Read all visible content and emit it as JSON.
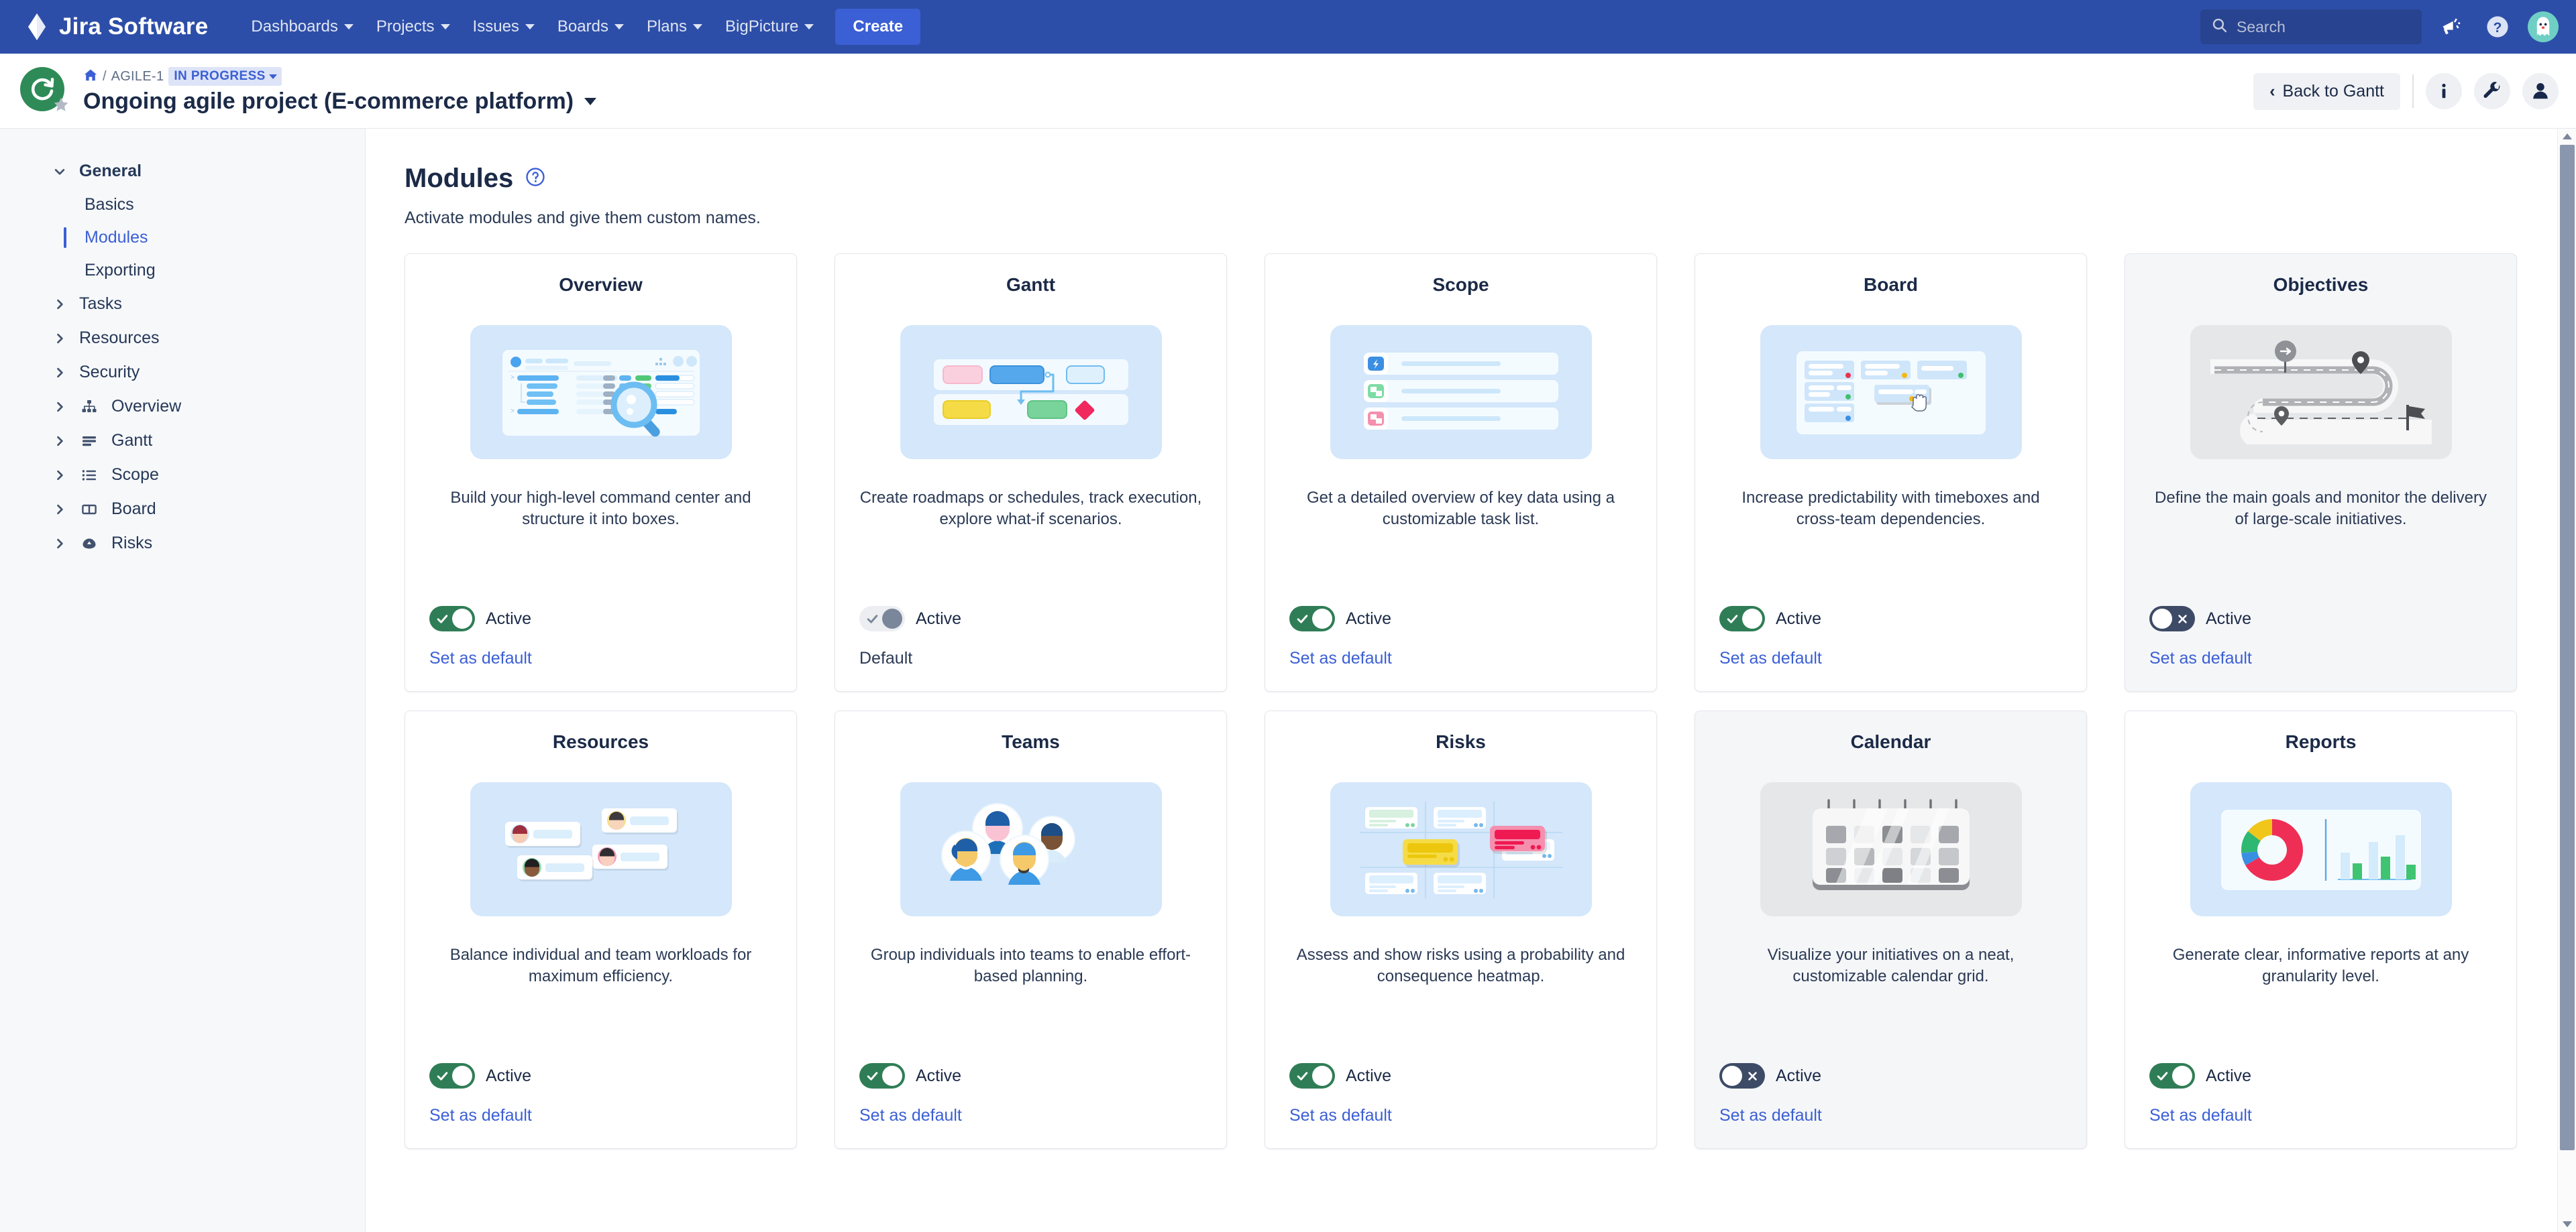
{
  "topnav": {
    "brand": "Jira Software",
    "menu": [
      {
        "label": "Dashboards",
        "has_caret": true
      },
      {
        "label": "Projects",
        "has_caret": true
      },
      {
        "label": "Issues",
        "has_caret": true
      },
      {
        "label": "Boards",
        "has_caret": true
      },
      {
        "label": "Plans",
        "has_caret": true
      },
      {
        "label": "BigPicture",
        "has_caret": true
      }
    ],
    "create_label": "Create",
    "search_placeholder": "Search",
    "icons": [
      "megaphone-icon",
      "help-icon",
      "user-avatar"
    ],
    "bg_color": "#2d4ea8",
    "create_bg": "#3b5fd4"
  },
  "project_header": {
    "breadcrumb_home": "home-icon",
    "breadcrumb_separator": "/",
    "breadcrumb_key": "AGILE-1",
    "status": "IN PROGRESS",
    "status_color": "#3b5fd4",
    "status_bg": "#dde4f8",
    "title": "Ongoing agile project (E-commerce platform)",
    "back_button": "Back to Gantt",
    "actions": [
      "info-icon",
      "wrench-icon",
      "person-icon"
    ],
    "avatar_color": "#2e8b57"
  },
  "sidebar": {
    "groups": [
      {
        "label": "General",
        "expanded": true,
        "bold": true,
        "icon": null,
        "items": [
          {
            "label": "Basics",
            "active": false
          },
          {
            "label": "Modules",
            "active": true
          },
          {
            "label": "Exporting",
            "active": false
          }
        ]
      },
      {
        "label": "Tasks",
        "expanded": false,
        "bold": false,
        "icon": null,
        "items": []
      },
      {
        "label": "Resources",
        "expanded": false,
        "bold": false,
        "icon": null,
        "items": []
      },
      {
        "label": "Security",
        "expanded": false,
        "bold": false,
        "icon": null,
        "items": []
      },
      {
        "label": "Overview",
        "expanded": false,
        "bold": false,
        "icon": "sitemap-icon",
        "items": []
      },
      {
        "label": "Gantt",
        "expanded": false,
        "bold": false,
        "icon": "gantt-bars-icon",
        "items": []
      },
      {
        "label": "Scope",
        "expanded": false,
        "bold": false,
        "icon": "list-icon",
        "items": []
      },
      {
        "label": "Board",
        "expanded": false,
        "bold": false,
        "icon": "board-columns-icon",
        "items": []
      },
      {
        "label": "Risks",
        "expanded": false,
        "bold": false,
        "icon": "risk-icon",
        "items": []
      }
    ]
  },
  "main": {
    "title": "Modules",
    "help_icon": "question-circle-icon",
    "subtitle": "Activate modules and give them custom names.",
    "toggle_label": "Active",
    "set_default_label": "Set as default",
    "default_label": "Default",
    "cards": [
      {
        "name": "Overview",
        "description": "Build your high-level command center and structure it into boxes.",
        "illustration": "overview-illustration",
        "active": true,
        "toggle_state": "on",
        "footer_type": "link",
        "footer_label": "Set as default"
      },
      {
        "name": "Gantt",
        "description": "Create roadmaps or schedules, track execution, explore what-if scenarios.",
        "illustration": "gantt-illustration",
        "active": true,
        "toggle_state": "disabled",
        "footer_type": "text",
        "footer_label": "Default"
      },
      {
        "name": "Scope",
        "description": "Get a detailed overview of key data using a customizable task list.",
        "illustration": "scope-illustration",
        "active": true,
        "toggle_state": "on",
        "footer_type": "link",
        "footer_label": "Set as default"
      },
      {
        "name": "Board",
        "description": "Increase predictability with timeboxes and cross-team dependencies.",
        "illustration": "board-illustration",
        "active": true,
        "toggle_state": "on",
        "footer_type": "link",
        "footer_label": "Set as default"
      },
      {
        "name": "Objectives",
        "description": "Define the main goals and monitor the delivery of large-scale initiatives.",
        "illustration": "objectives-illustration",
        "active": false,
        "toggle_state": "off",
        "footer_type": "link",
        "footer_label": "Set as default"
      },
      {
        "name": "Resources",
        "description": "Balance individual and team workloads for maximum efficiency.",
        "illustration": "resources-illustration",
        "active": true,
        "toggle_state": "on",
        "footer_type": "link",
        "footer_label": "Set as default"
      },
      {
        "name": "Teams",
        "description": "Group individuals into teams to enable effort-based planning.",
        "illustration": "teams-illustration",
        "active": true,
        "toggle_state": "on",
        "footer_type": "link",
        "footer_label": "Set as default"
      },
      {
        "name": "Risks",
        "description": "Assess and show risks using a probability and consequence heatmap.",
        "illustration": "risks-illustration",
        "active": true,
        "toggle_state": "on",
        "footer_type": "link",
        "footer_label": "Set as default"
      },
      {
        "name": "Calendar",
        "description": "Visualize your initiatives on a neat, customizable calendar grid.",
        "illustration": "calendar-illustration",
        "active": false,
        "toggle_state": "off",
        "footer_type": "link",
        "footer_label": "Set as default"
      },
      {
        "name": "Reports",
        "description": "Generate clear, informative reports at any granularity level.",
        "illustration": "reports-illustration",
        "active": true,
        "toggle_state": "on",
        "footer_type": "link",
        "footer_label": "Set as default"
      }
    ]
  },
  "colors": {
    "toggle_on": "#2f7d56",
    "toggle_off": "#3e4b66",
    "link": "#3b5fd4",
    "card_inactive_bg": "#f5f6f8",
    "illus_bg": "#d4e7fb"
  }
}
